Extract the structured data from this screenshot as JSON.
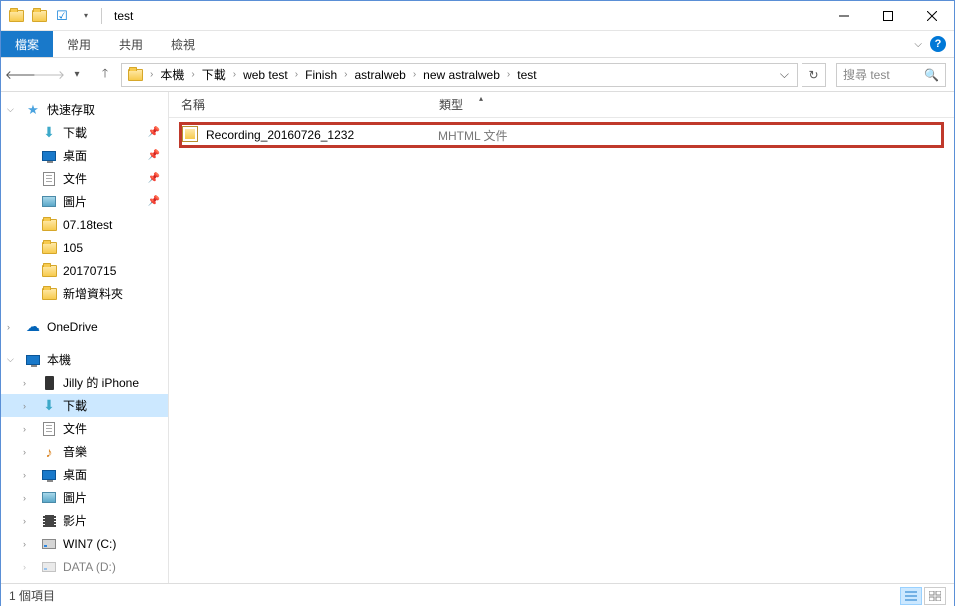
{
  "window": {
    "title": "test"
  },
  "ribbon": {
    "file": "檔案",
    "tabs": [
      "常用",
      "共用",
      "檢視"
    ]
  },
  "breadcrumb": {
    "items": [
      "本機",
      "下載",
      "web test",
      "Finish",
      "astralweb",
      "new astralweb",
      "test"
    ]
  },
  "search": {
    "placeholder": "搜尋 test"
  },
  "nav": {
    "quick_access": "快速存取",
    "quick_items": [
      {
        "label": "下載",
        "icon": "download",
        "pinned": true
      },
      {
        "label": "桌面",
        "icon": "monitor",
        "pinned": true
      },
      {
        "label": "文件",
        "icon": "doc",
        "pinned": true
      },
      {
        "label": "圖片",
        "icon": "pic",
        "pinned": true
      },
      {
        "label": "07.18test",
        "icon": "folder",
        "pinned": false
      },
      {
        "label": "105",
        "icon": "folder",
        "pinned": false
      },
      {
        "label": "20170715",
        "icon": "folder",
        "pinned": false
      },
      {
        "label": "新增資料夾",
        "icon": "folder",
        "pinned": false
      }
    ],
    "onedrive": "OneDrive",
    "this_pc": "本機",
    "pc_items": [
      {
        "label": "Jilly 的 iPhone",
        "icon": "phone"
      },
      {
        "label": "下載",
        "icon": "download",
        "selected": true
      },
      {
        "label": "文件",
        "icon": "doc"
      },
      {
        "label": "音樂",
        "icon": "music"
      },
      {
        "label": "桌面",
        "icon": "monitor"
      },
      {
        "label": "圖片",
        "icon": "pic"
      },
      {
        "label": "影片",
        "icon": "film"
      },
      {
        "label": "WIN7 (C:)",
        "icon": "drive"
      },
      {
        "label": "DATA (D:)",
        "icon": "drive"
      }
    ]
  },
  "columns": {
    "name": "名稱",
    "type": "類型"
  },
  "files": [
    {
      "name": "Recording_20160726_1232",
      "type": "MHTML 文件",
      "highlighted": true
    }
  ],
  "status": {
    "text": "1 個項目"
  }
}
